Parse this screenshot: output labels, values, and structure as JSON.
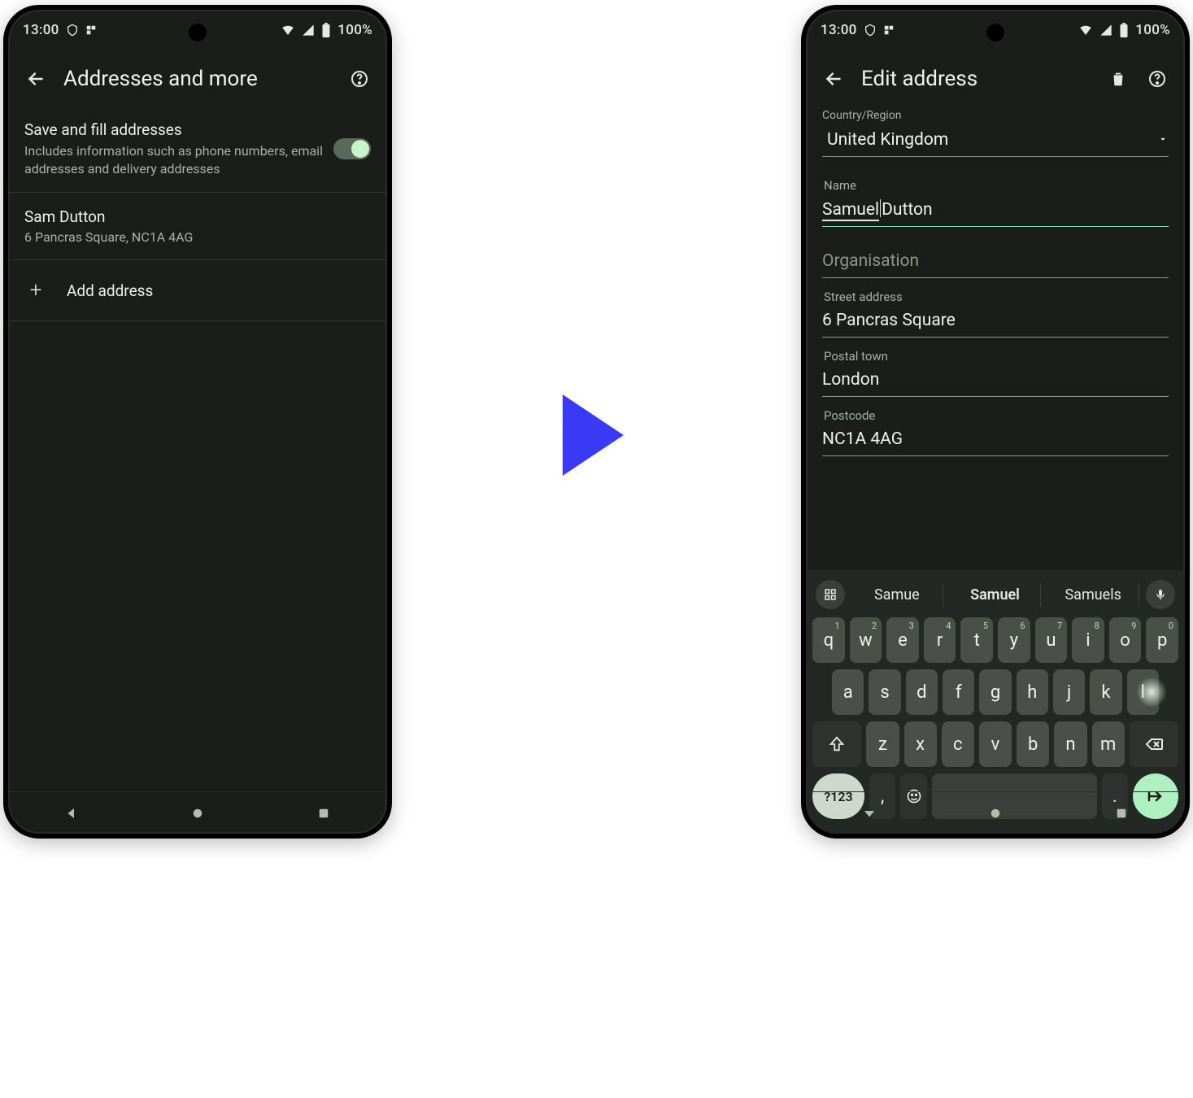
{
  "status": {
    "time": "13:00",
    "battery": "100%"
  },
  "screen1": {
    "title": "Addresses and more",
    "toggle": {
      "title": "Save and fill addresses",
      "sub": "Includes information such as phone numbers, email addresses and delivery addresses"
    },
    "address": {
      "name": "Sam Dutton",
      "line2": "6 Pancras Square, NC1A 4AG"
    },
    "add_label": "Add address"
  },
  "screen2": {
    "title": "Edit address",
    "country_label": "Country/Region",
    "country_value": "United Kingdom",
    "name_label": "Name",
    "name_part1": "Samuel",
    "name_part2": "Dutton",
    "org_placeholder": "Organisation",
    "street_label": "Street address",
    "street_value": "6 Pancras Square",
    "town_label": "Postal town",
    "town_value": "London",
    "postcode_label": "Postcode",
    "postcode_value": "NC1A 4AG",
    "suggestions": [
      "Samue",
      "Samuel",
      "Samuels"
    ]
  },
  "keyboard": {
    "row1": [
      [
        "q",
        "1"
      ],
      [
        "w",
        "2"
      ],
      [
        "e",
        "3"
      ],
      [
        "r",
        "4"
      ],
      [
        "t",
        "5"
      ],
      [
        "y",
        "6"
      ],
      [
        "u",
        "7"
      ],
      [
        "i",
        "8"
      ],
      [
        "o",
        "9"
      ],
      [
        "p",
        "0"
      ]
    ],
    "row2": [
      "a",
      "s",
      "d",
      "f",
      "g",
      "h",
      "j",
      "k",
      "l"
    ],
    "row3": [
      "z",
      "x",
      "c",
      "v",
      "b",
      "n",
      "m"
    ],
    "numkey": "?123",
    "comma": ",",
    "period": "."
  }
}
